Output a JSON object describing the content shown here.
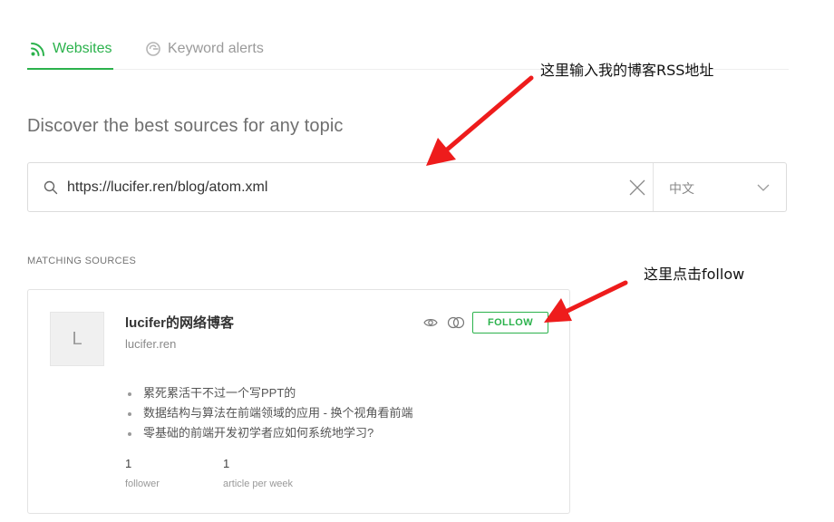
{
  "tabs": [
    {
      "label": "Websites",
      "icon": "rss-icon",
      "active": true
    },
    {
      "label": "Keyword alerts",
      "icon": "google-icon",
      "active": false
    }
  ],
  "heading": "Discover the best sources for any topic",
  "search": {
    "value": "https://lucifer.ren/blog/atom.xml",
    "language": "中文"
  },
  "section_label": "MATCHING SOURCES",
  "source": {
    "avatar_letter": "L",
    "title": "lucifer的网络博客",
    "domain": "lucifer.ren",
    "follow_label": "FOLLOW",
    "articles": [
      "累死累活干不过一个写PPT的",
      "数据结构与算法在前端领域的应用 - 换个视角看前端",
      "零基础的前端开发初学者应如何系统地学习?"
    ],
    "stats": [
      {
        "value": "1",
        "label": "follower"
      },
      {
        "value": "1",
        "label": "article per week"
      }
    ]
  },
  "annotations": [
    "这里输入我的博客RSS地址",
    "这里点击follow"
  ],
  "colors": {
    "accent": "#2bb24c",
    "annotation_arrow": "#ee1c1c"
  }
}
